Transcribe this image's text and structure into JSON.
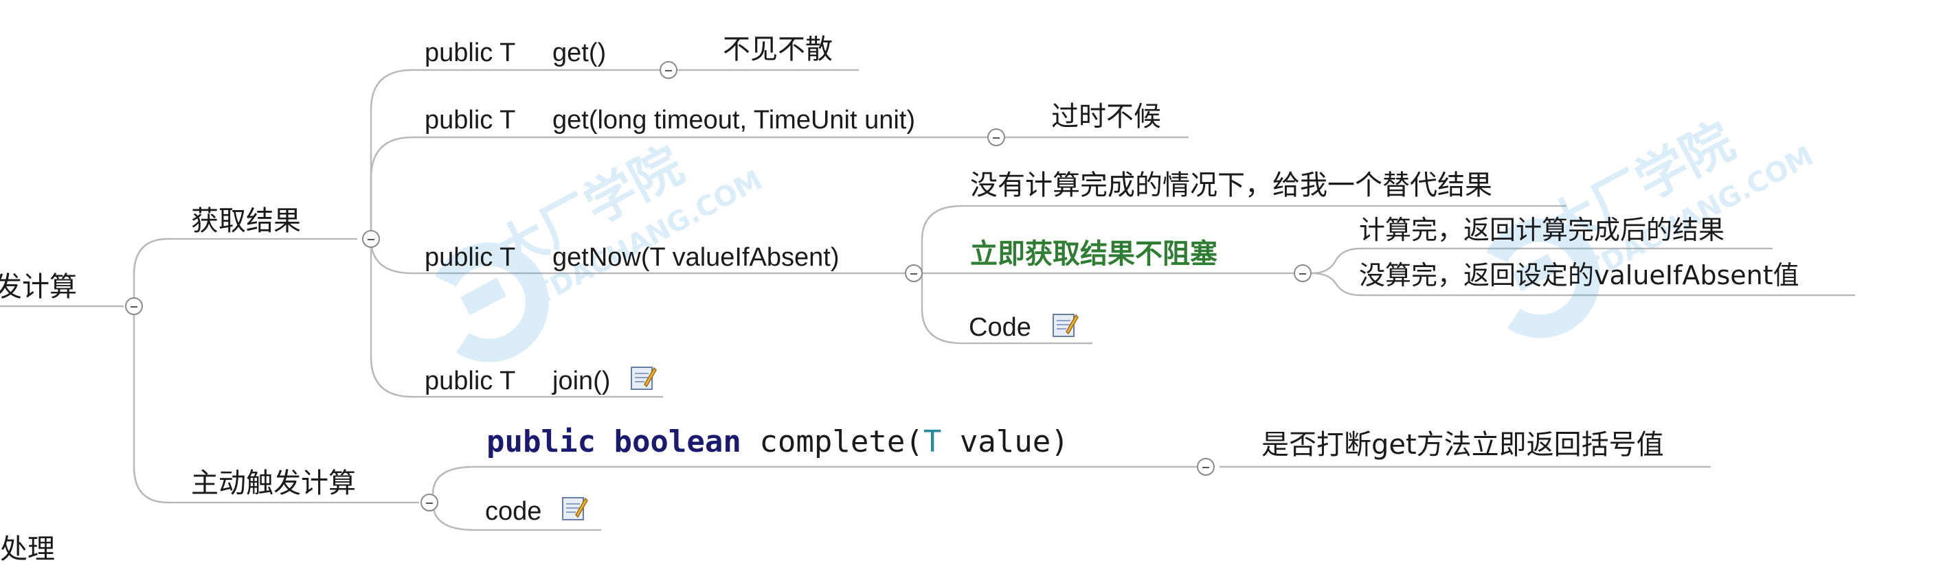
{
  "root": {
    "label": "发计算"
  },
  "branches": {
    "get_result": {
      "label": "获取结果",
      "get": {
        "modifier": "public T",
        "signature": "get()",
        "note": "不见不散"
      },
      "get_timeout": {
        "modifier": "public T",
        "signature": "get(long timeout, TimeUnit unit)",
        "note": "过时不候"
      },
      "get_now": {
        "modifier": "public T",
        "signature": "getNow(T valueIfAbsent)",
        "alt_result": "没有计算完成的情况下，给我一个替代结果",
        "immediate": "立即获取结果不阻塞",
        "done": "计算完，返回计算完成后的结果",
        "not_done": "没算完，返回设定的valueIfAbsent值",
        "code": "Code"
      },
      "join": {
        "modifier": "public T",
        "signature": "join()"
      }
    },
    "trigger": {
      "label": "主动触发计算",
      "complete": {
        "kw_public": "public",
        "kw_boolean": "boolean",
        "method": "complete(",
        "type": "T",
        "param": "value)",
        "note": "是否打断get方法立即返回括号值"
      },
      "code": "code"
    }
  },
  "watermark": {
    "brand": "大厂学院",
    "site": "ITDACHANG.COM"
  },
  "partial_bottom": "拓处理",
  "colors": {
    "keyword": "#1a1a6e",
    "type": "#2a8a9a",
    "green": "#2e7d32",
    "line": "#b9b9b9",
    "watermark": "#5ab0e0"
  }
}
